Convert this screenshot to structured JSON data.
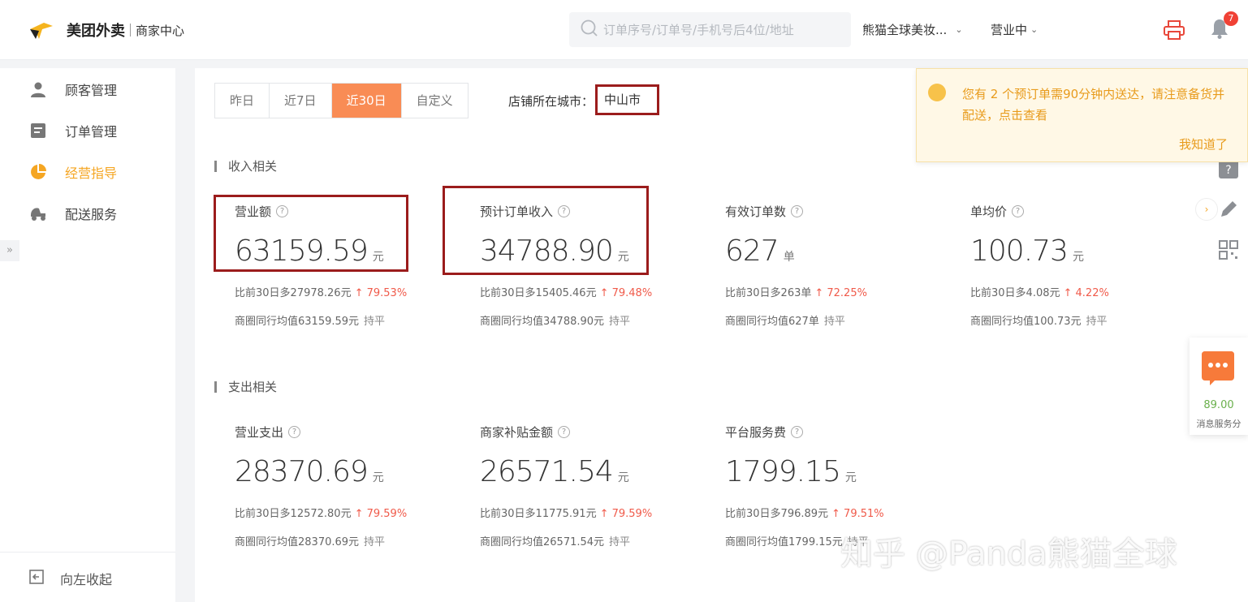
{
  "header": {
    "brand": "美团外卖",
    "brand_sub": "商家中心",
    "search_placeholder": "订单序号/订单号/手机号后4位/地址",
    "shop_name": "熊猫全球美妆...",
    "status": "营业中",
    "notification_count": "7"
  },
  "sidebar": {
    "items": [
      {
        "label": "顾客管理",
        "icon": "users-icon"
      },
      {
        "label": "订单管理",
        "icon": "orders-icon"
      },
      {
        "label": "经营指导",
        "icon": "pie-chart-icon"
      },
      {
        "label": "配送服务",
        "icon": "delivery-icon"
      }
    ],
    "active_index": 2,
    "collapse_label": "向左收起"
  },
  "filters": {
    "tabs": [
      "昨日",
      "近7日",
      "近30日",
      "自定义"
    ],
    "active_tab": 2,
    "city_label": "店铺所在城市：",
    "city_value": "中山市"
  },
  "income": {
    "title": "收入相关",
    "metrics": [
      {
        "label": "营业额",
        "value": "63159.59",
        "unit": "元",
        "compare": "比前30日多27978.26元",
        "pct": "↑ 79.53%",
        "avg": "商圈同行均值63159.59元",
        "avg_status": "持平"
      },
      {
        "label": "预计订单收入",
        "value": "34788.90",
        "unit": "元",
        "compare": "比前30日多15405.46元",
        "pct": "↑ 79.48%",
        "avg": "商圈同行均值34788.90元",
        "avg_status": "持平"
      },
      {
        "label": "有效订单数",
        "value": "627",
        "unit": "单",
        "compare": "比前30日多263单",
        "pct": "↑ 72.25%",
        "avg": "商圈同行均值627单",
        "avg_status": "持平"
      },
      {
        "label": "单均价",
        "value": "100.73",
        "unit": "元",
        "compare": "比前30日多4.08元",
        "pct": "↑ 4.22%",
        "avg": "商圈同行均值100.73元",
        "avg_status": "持平"
      }
    ]
  },
  "expense": {
    "title": "支出相关",
    "metrics": [
      {
        "label": "营业支出",
        "value": "28370.69",
        "unit": "元",
        "compare": "比前30日多12572.80元",
        "pct": "↑ 79.59%",
        "avg": "商圈同行均值28370.69元",
        "avg_status": "持平"
      },
      {
        "label": "商家补贴金额",
        "value": "26571.54",
        "unit": "元",
        "compare": "比前30日多11775.91元",
        "pct": "↑ 79.59%",
        "avg": "商圈同行均值26571.54元",
        "avg_status": "持平"
      },
      {
        "label": "平台服务费",
        "value": "1799.15",
        "unit": "元",
        "compare": "比前30日多796.89元",
        "pct": "↑ 79.51%",
        "avg": "商圈同行均值1799.15元",
        "avg_status": "持平"
      }
    ]
  },
  "notice": {
    "text": "您有 2 个预订单需90分钟内送达，请注意备货并配送，点击查看",
    "confirm": "我知道了"
  },
  "chat_widget": {
    "score": "89.00",
    "label": "消息服务分"
  },
  "watermark": "知乎 @Panda熊猫全球",
  "colors": {
    "accent": "#f98c55",
    "brand_yellow": "#f5a623",
    "highlight_box": "#9b1c1c",
    "increase": "#f05a4a"
  }
}
